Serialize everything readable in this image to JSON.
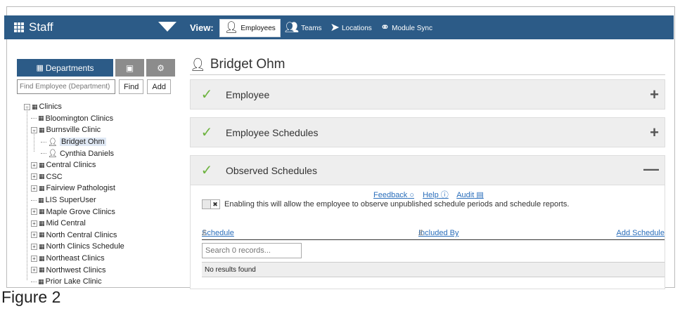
{
  "app": {
    "title": "Staff"
  },
  "view": {
    "label": "View:",
    "tabs": [
      {
        "label": "Employees",
        "icon": "person-icon",
        "active": true
      },
      {
        "label": "Teams",
        "icon": "team-icon",
        "active": false
      },
      {
        "label": "Locations",
        "icon": "location-arrow-icon",
        "active": false
      },
      {
        "label": "Module Sync",
        "icon": "link-icon",
        "active": false
      }
    ]
  },
  "left": {
    "tabs": {
      "departments": "Departments"
    },
    "search": {
      "placeholder": "Find Employee (Department)"
    },
    "find_label": "Find",
    "add_label": "Add",
    "tree": [
      {
        "label": "Clinics",
        "type": "dept",
        "level": 0,
        "expander": "−"
      },
      {
        "label": "Bloomington Clinics",
        "type": "dept",
        "level": 1
      },
      {
        "label": "Burnsville Clinic",
        "type": "dept",
        "level": 1,
        "expander": "−"
      },
      {
        "label": "Bridget Ohm",
        "type": "person",
        "level": 2,
        "selected": true
      },
      {
        "label": "Cynthia Daniels",
        "type": "person",
        "level": 2
      },
      {
        "label": "Central Clinics",
        "type": "dept",
        "level": 1,
        "expander": "+"
      },
      {
        "label": "CSC",
        "type": "dept",
        "level": 1,
        "expander": "+"
      },
      {
        "label": "Fairview Pathologist",
        "type": "dept",
        "level": 1,
        "expander": "+"
      },
      {
        "label": "LIS SuperUser",
        "type": "dept",
        "level": 1
      },
      {
        "label": "Maple Grove Clinics",
        "type": "dept",
        "level": 1,
        "expander": "+"
      },
      {
        "label": "Mid Central",
        "type": "dept",
        "level": 1,
        "expander": "+"
      },
      {
        "label": "North Central Clinics",
        "type": "dept",
        "level": 1,
        "expander": "+"
      },
      {
        "label": "North Clinics Schedule",
        "type": "dept",
        "level": 1,
        "expander": "+"
      },
      {
        "label": "Northeast Clinics",
        "type": "dept",
        "level": 1,
        "expander": "+"
      },
      {
        "label": "Northwest Clinics",
        "type": "dept",
        "level": 1,
        "expander": "+"
      },
      {
        "label": "Prior Lake Clinic",
        "type": "dept",
        "level": 1
      }
    ]
  },
  "main": {
    "person_name": "Bridget Ohm",
    "panels": {
      "employee": "Employee",
      "employee_schedules": "Employee Schedules",
      "observed_schedules": "Observed Schedules"
    },
    "links": {
      "feedback": "Feedback",
      "help": "Help",
      "audit": "Audit"
    },
    "toggle_text": "Enabling this will allow the employee to observe unpublished schedule periods and schedule reports.",
    "table": {
      "col_schedule": "Schedule",
      "col_included_by": "Included By",
      "add_schedule": "Add Schedule",
      "search_placeholder": "Search 0 records...",
      "empty": "No results found"
    }
  },
  "caption": "Figure 2",
  "colors": {
    "header": "#2c5b87",
    "check": "#6db33f",
    "link": "#2a6ebb"
  }
}
